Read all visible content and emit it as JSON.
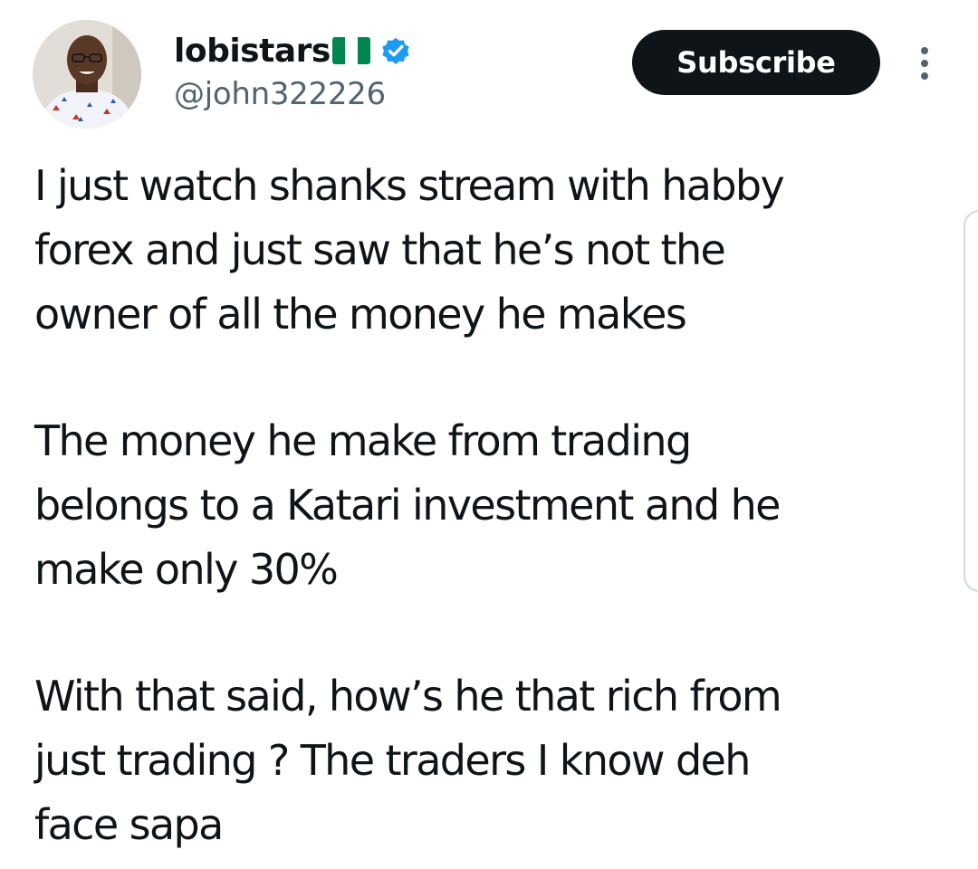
{
  "author": {
    "display_name": "lobistars",
    "flag_icon": "nigeria-flag-icon",
    "verified_icon": "verified-badge-icon",
    "handle": "@john322226",
    "avatar_icon": "profile-avatar"
  },
  "actions": {
    "subscribe_label": "Subscribe",
    "more_icon": "more-vertical-icon"
  },
  "tweet": {
    "paragraphs": [
      [
        "I just watch shanks stream with habby",
        "forex and just saw that he’s not the",
        "owner of all the money he makes"
      ],
      [
        "The money he make from trading",
        "belongs to a Katari investment and he",
        "make only 30%"
      ],
      [
        "With that said, how’s he that rich from",
        "just trading ? The traders I know deh",
        "face sapa"
      ]
    ]
  },
  "colors": {
    "text_primary": "#0f1419",
    "text_secondary": "#536471",
    "verified_blue": "#1d9bf0",
    "button_bg": "#0f1419",
    "flag_green": "#008751"
  }
}
